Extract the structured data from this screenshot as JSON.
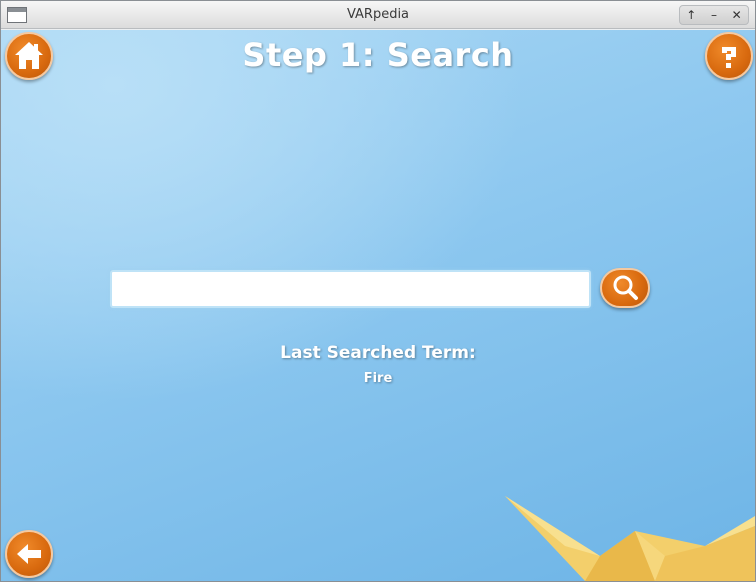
{
  "window": {
    "title": "VARpedia",
    "controls": {
      "maximize": "↑",
      "minimize": "–",
      "close": "✕"
    }
  },
  "header": {
    "title": "Step 1: Search",
    "home_icon": "home-icon",
    "help_icon": "question-icon"
  },
  "search": {
    "value": "",
    "placeholder": "",
    "button_icon": "search-icon"
  },
  "last_search": {
    "label": "Last Searched Term:",
    "value": "Fire"
  },
  "footer": {
    "back_icon": "arrow-left-icon"
  },
  "colors": {
    "accent": "#d8690e",
    "background": "#8cc7ef",
    "text": "#ffffff"
  }
}
